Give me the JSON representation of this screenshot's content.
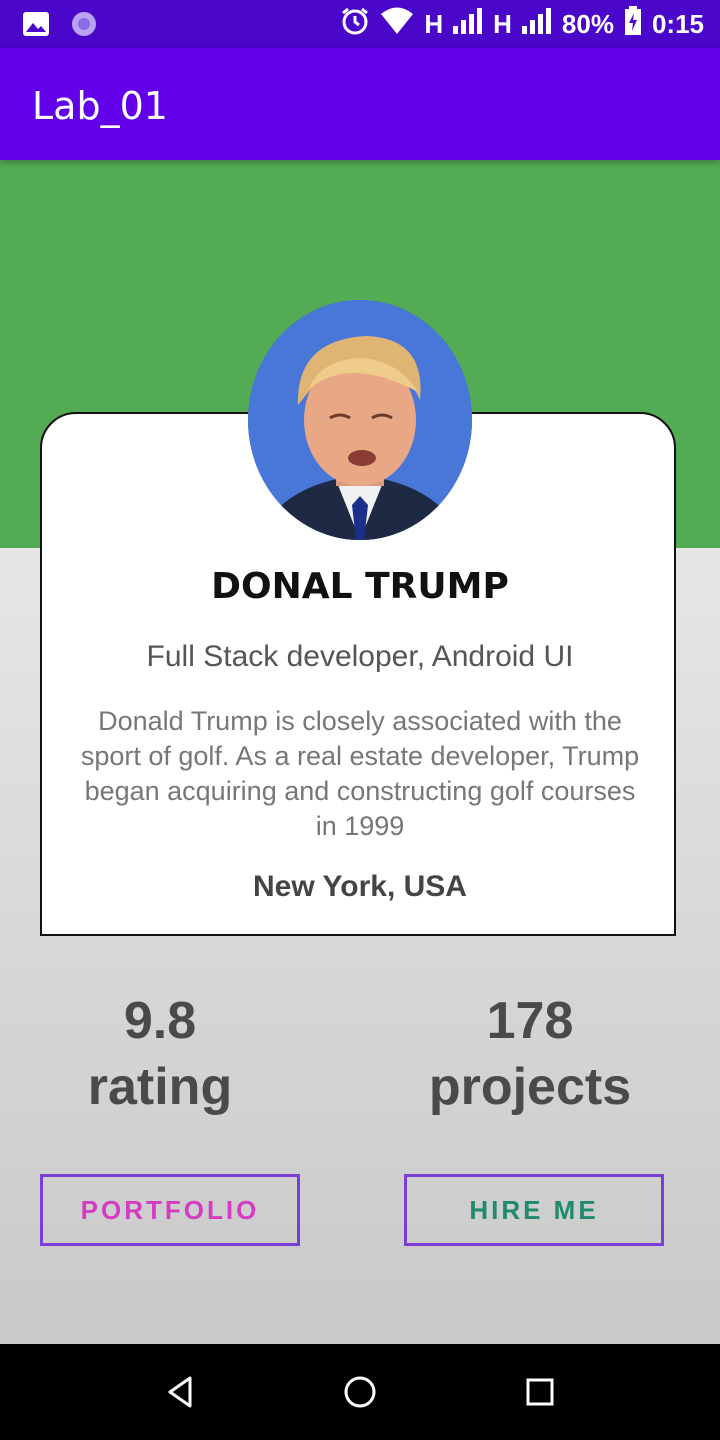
{
  "status_bar": {
    "network_left": "H",
    "network_right": "H",
    "battery": "80%",
    "time": "0:15",
    "icons": [
      "image-icon",
      "sync-icon",
      "alarm-icon",
      "wifi-icon",
      "signal-icon",
      "battery-icon"
    ]
  },
  "app_bar": {
    "title": "Lab_01"
  },
  "profile": {
    "name": "DONAL TRUMP",
    "role": "Full Stack developer, Android UI",
    "bio": "Donald Trump is closely associated with the sport of golf. As a real estate developer, Trump began acquiring and constructing golf courses in 1999",
    "location": "New York, USA"
  },
  "stats": {
    "rating_value": "9.8",
    "rating_label": "rating",
    "projects_value": "178",
    "projects_label": "projects"
  },
  "buttons": {
    "portfolio": "PORTFOLIO",
    "hire": "HIRE ME"
  },
  "colors": {
    "status_bar": "#4a06c9",
    "app_bar": "#6200ea",
    "header_green": "#53ab53",
    "button_border": "#7b3fd8",
    "portfolio_text": "#d63bc4",
    "hire_text": "#1f8a6e"
  }
}
